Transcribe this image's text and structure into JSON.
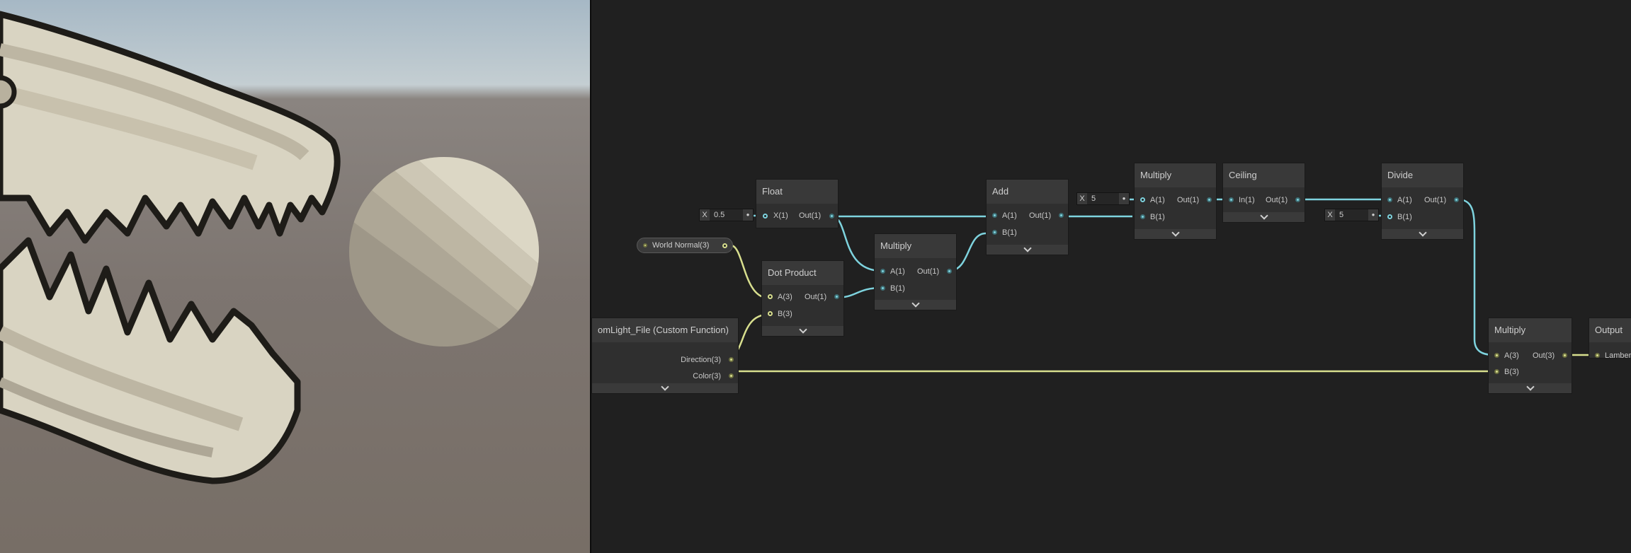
{
  "viewport": {
    "sky": "#b8c6cd",
    "ground": "#7a726c",
    "skull_fill": "#d9d4c2",
    "outline": "#1e1c18"
  },
  "nodes": {
    "float": {
      "title": "Float",
      "field_label": "X",
      "field_value": "0.5",
      "in": "X(1)",
      "out": "Out(1)"
    },
    "world_normal": {
      "label": "World Normal(3)"
    },
    "dot_product": {
      "title": "Dot Product",
      "in_a": "A(3)",
      "in_b": "B(3)",
      "out": "Out(1)"
    },
    "multiply1": {
      "title": "Multiply",
      "in_a": "A(1)",
      "in_b": "B(1)",
      "out": "Out(1)"
    },
    "add": {
      "title": "Add",
      "in_a": "A(1)",
      "in_b": "B(1)",
      "out": "Out(1)"
    },
    "multiply2": {
      "title": "Multiply",
      "field_label": "X",
      "field_value": "5",
      "in_a": "A(1)",
      "in_b": "B(1)",
      "out": "Out(1)"
    },
    "ceiling": {
      "title": "Ceiling",
      "in": "In(1)",
      "out": "Out(1)"
    },
    "divide": {
      "title": "Divide",
      "field_label": "X",
      "field_value": "5",
      "in_a": "A(1)",
      "in_b": "B(1)",
      "out": "Out(1)"
    },
    "custom": {
      "title": "omLight_File (Custom Function)",
      "out1": "Direction(3)",
      "out2": "Color(3)"
    },
    "multiply3": {
      "title": "Multiply",
      "in_a": "A(3)",
      "in_b": "B(3)",
      "out": "Out(3)"
    },
    "output": {
      "title": "Output",
      "in": "Lamber"
    }
  },
  "colors": {
    "float_wire": "#7ed3de",
    "vector_wire": "#d8df8e",
    "node_header": "#393939",
    "graph_bg": "#202020"
  }
}
